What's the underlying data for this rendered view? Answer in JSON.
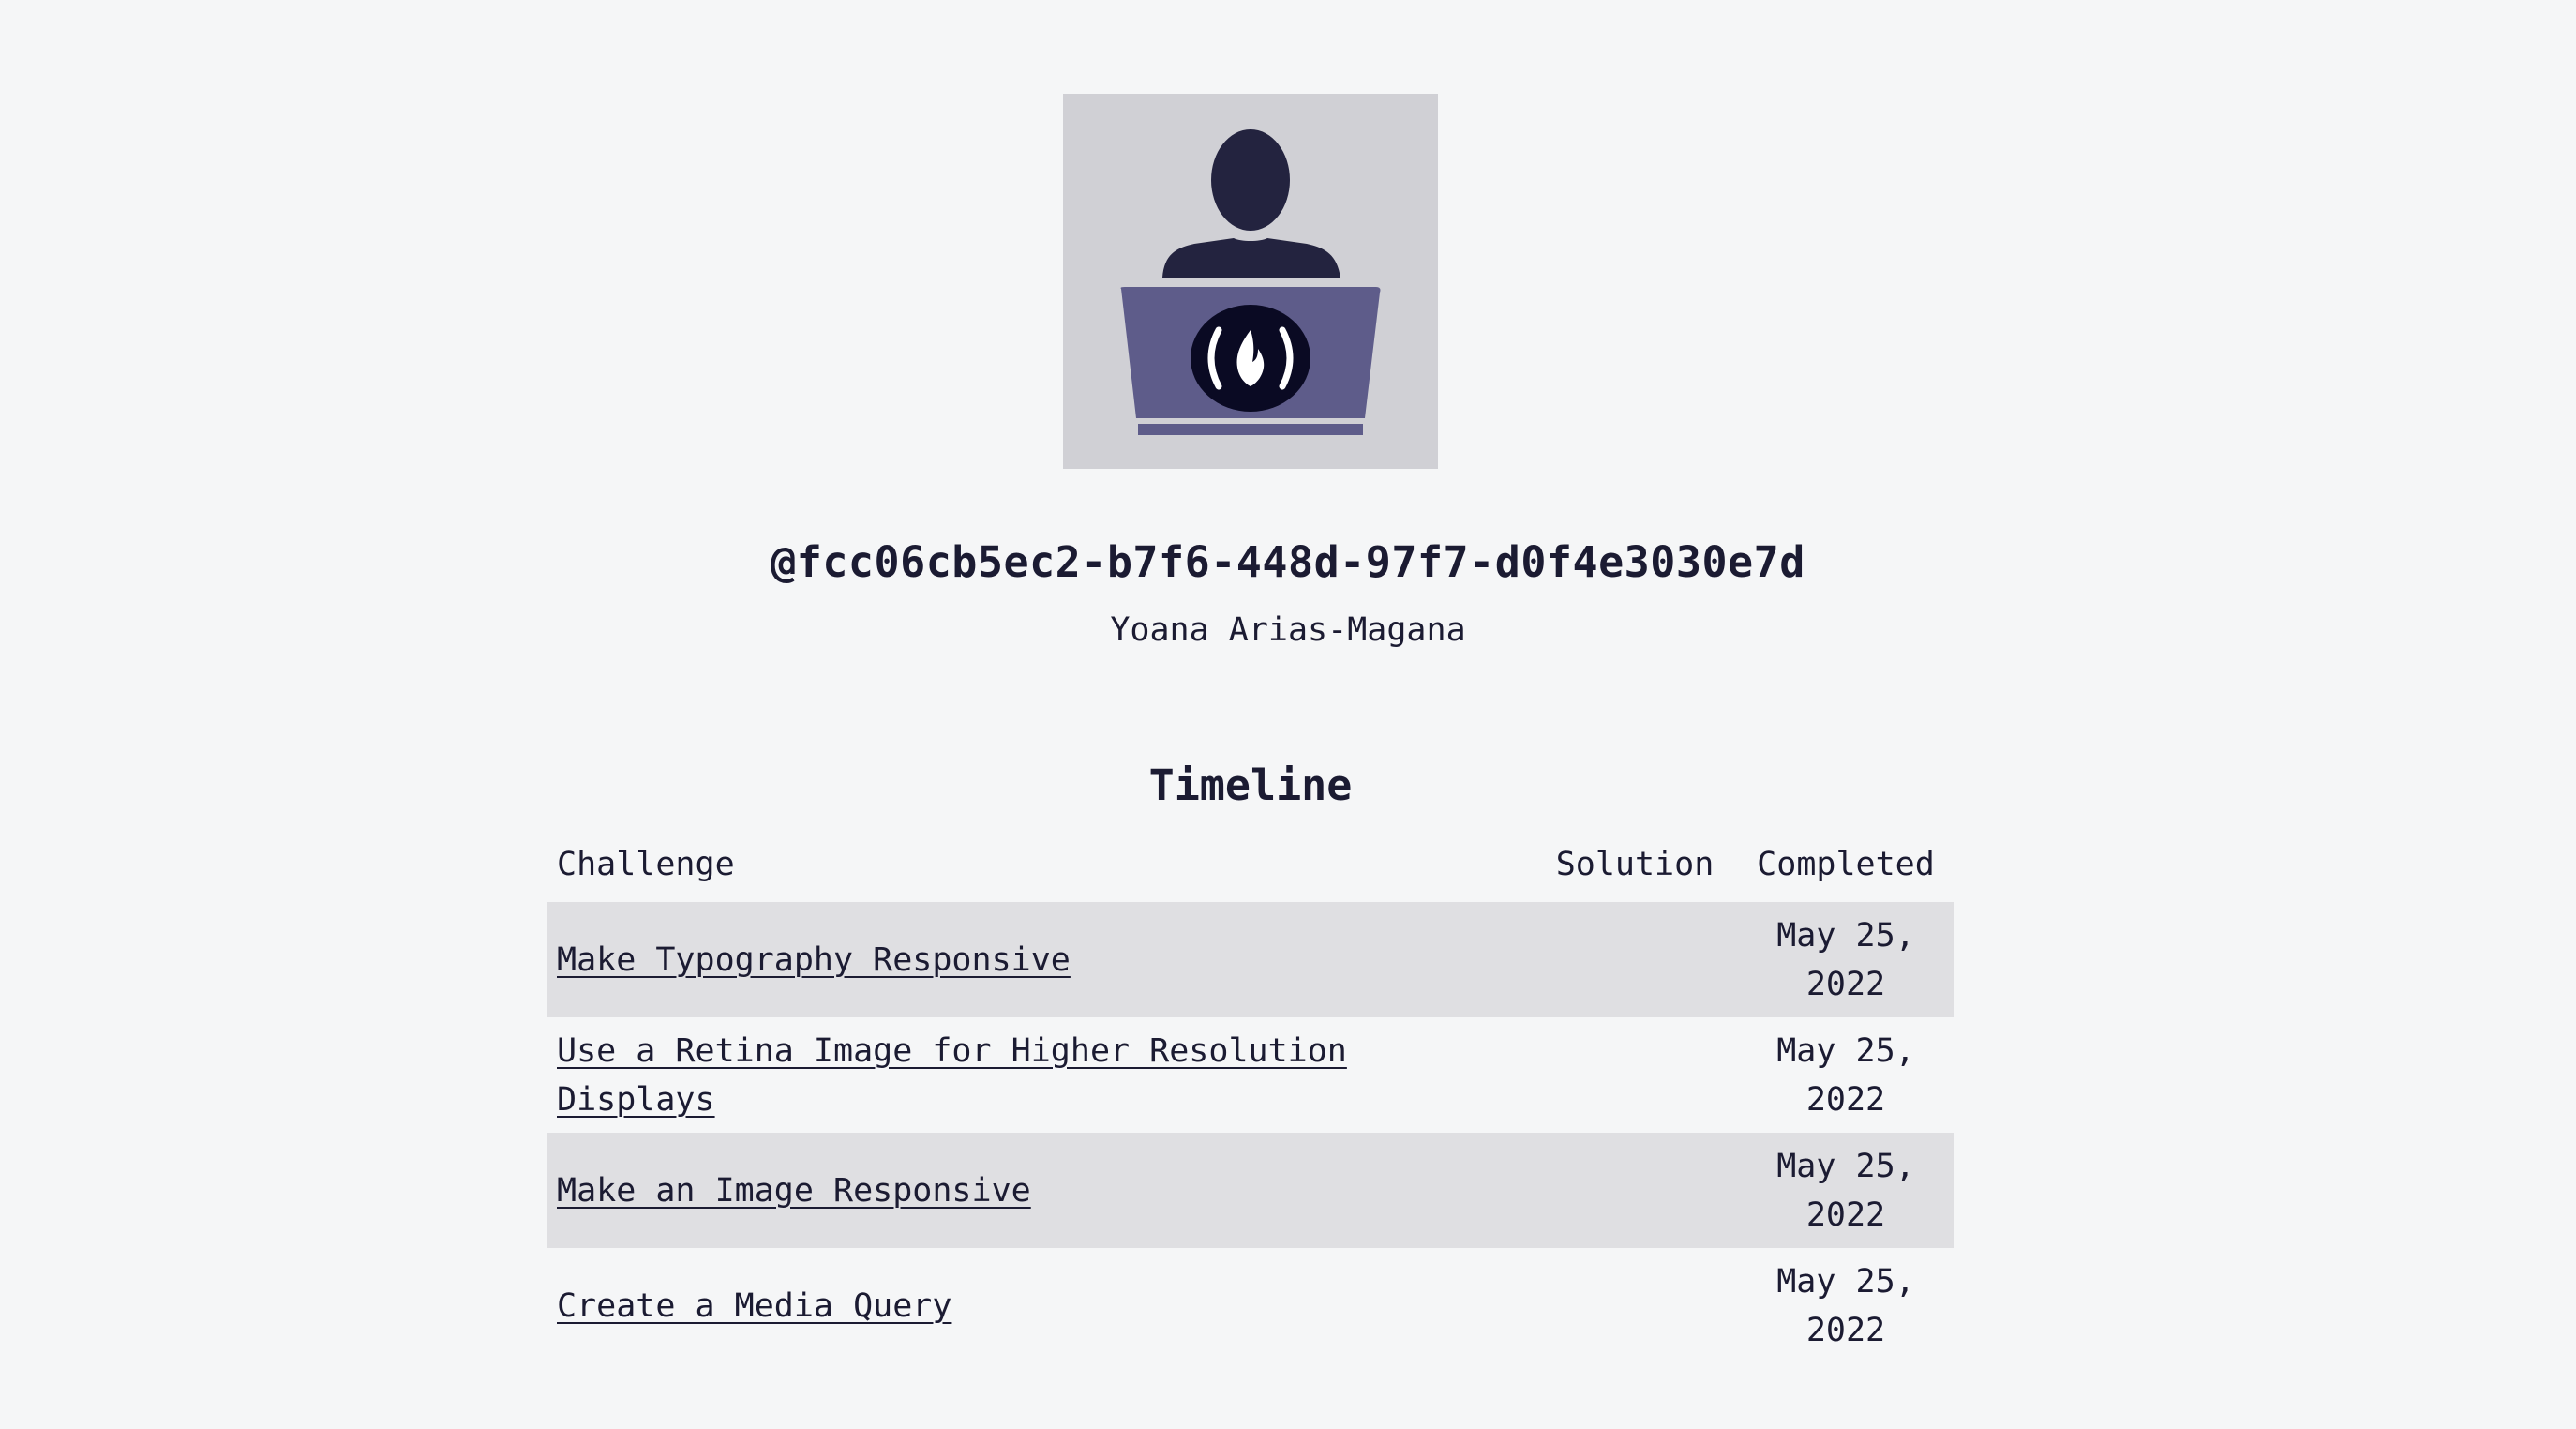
{
  "profile": {
    "avatar_icon": "camper-avatar-icon",
    "username": "@fcc06cb5ec2-b7f6-448d-97f7-d0f4e3030e7d",
    "name": "Yoana Arias-Magana"
  },
  "timeline": {
    "heading": "Timeline",
    "columns": {
      "challenge": "Challenge",
      "solution": "Solution",
      "completed": "Completed"
    },
    "rows": [
      {
        "challenge": "Make Typography Responsive",
        "solution": "",
        "completed_line1": "May 25,",
        "completed_line2": "2022"
      },
      {
        "challenge": "Use a Retina Image for Higher Resolution Displays",
        "solution": "",
        "completed_line1": "May 25,",
        "completed_line2": "2022"
      },
      {
        "challenge": "Make an Image Responsive",
        "solution": "",
        "completed_line1": "May 25,",
        "completed_line2": "2022"
      },
      {
        "challenge": "Create a Media Query",
        "solution": "",
        "completed_line1": "May 25,",
        "completed_line2": "2022"
      }
    ]
  },
  "colors": {
    "background": "#f5f6f7",
    "text": "#1b1b32",
    "avatar_bg": "#d0d0d5",
    "row_stripe": "#dfdfe2",
    "laptop": "#5e5c8a",
    "person": "#23233f"
  }
}
